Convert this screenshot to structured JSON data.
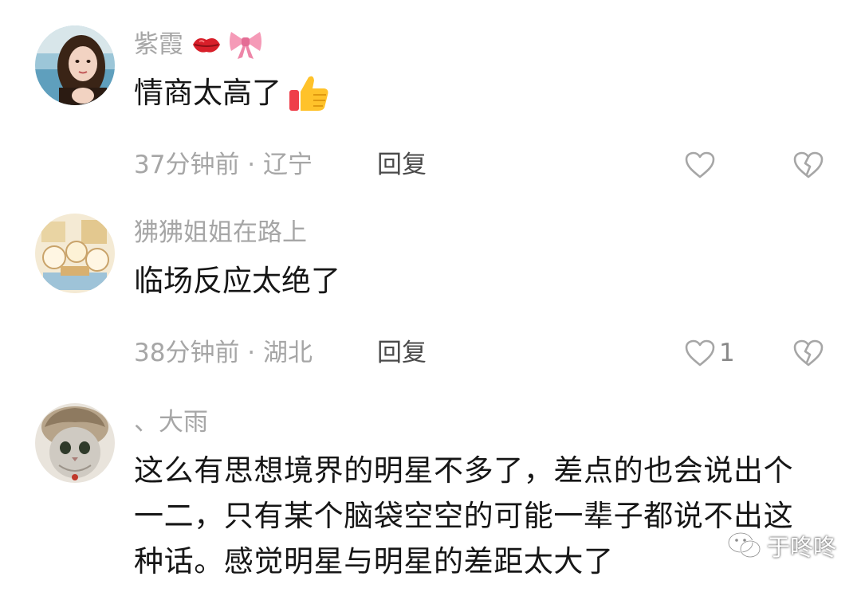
{
  "comments": [
    {
      "username": "紫霞",
      "text": "情商太高了",
      "time": "37分钟前 · 辽宁",
      "reply": "回复",
      "likes": ""
    },
    {
      "username": "狒狒姐姐在路上",
      "text": "临场反应太绝了",
      "time": "38分钟前 · 湖北",
      "reply": "回复",
      "likes": "1"
    },
    {
      "username": "、大雨",
      "text": "这么有思想境界的明星不多了，差点的也会说出个一二，只有某个脑袋空空的可能一辈子都说不出这种话。感觉明星与明星的差距太大了"
    }
  ],
  "watermark": "于咚咚",
  "icons": {
    "like": "heart-outline-icon",
    "dislike": "broken-heart-icon",
    "emoji_lips": "kiss-mark-icon",
    "emoji_bow": "ribbon-bow-icon",
    "emoji_thumb": "thumbs-up-icon",
    "wechat": "wechat-icon"
  },
  "colors": {
    "secondary_text": "#a6a6a6",
    "primary_text": "#161616",
    "reply_text": "#4a4a4a"
  }
}
